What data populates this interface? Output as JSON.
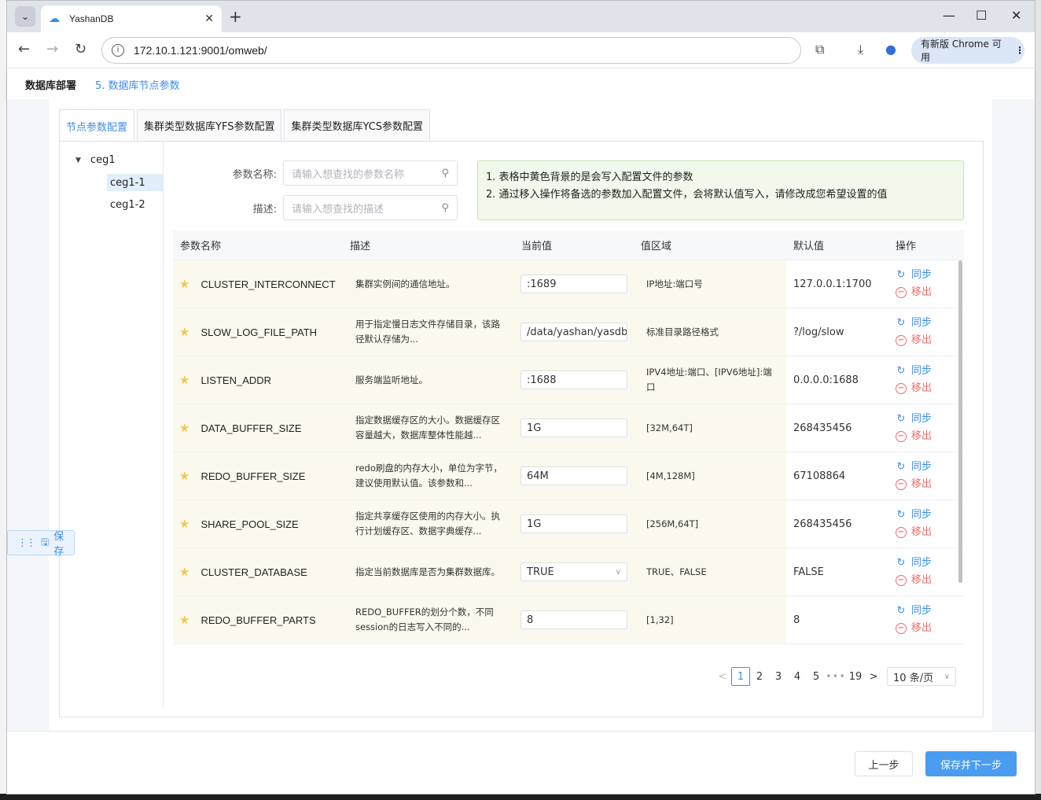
{
  "browser": {
    "tab_title": "YashanDB",
    "url": "172.10.1.121:9001/omweb/",
    "update_label": "有新版 Chrome 可用"
  },
  "header": {
    "section": "数据库部署",
    "step": "5. 数据库节点参数"
  },
  "tabs": [
    {
      "label": "节点参数配置",
      "active": true
    },
    {
      "label": "集群类型数据库YFS参数配置",
      "active": false
    },
    {
      "label": "集群类型数据库YCS参数配置",
      "active": false
    }
  ],
  "tree": {
    "root": "ceg1",
    "children": [
      "ceg1-1",
      "ceg1-2"
    ],
    "selected": "ceg1-1"
  },
  "search": {
    "name_label": "参数名称:",
    "name_placeholder": "请输入想查找的参数名称",
    "desc_label": "描述:",
    "desc_placeholder": "请输入想查找的描述"
  },
  "notice": {
    "line1": "1. 表格中黄色背景的是会写入配置文件的参数",
    "line2": "2. 通过移入操作将备选的参数加入配置文件，会将默认值写入，请修改成您希望设置的值"
  },
  "table": {
    "columns": [
      "参数名称",
      "描述",
      "当前值",
      "值区域",
      "默认值",
      "操作"
    ],
    "sync_label": "同步",
    "remove_label": "移出",
    "rows": [
      {
        "name": "CLUSTER_INTERCONNECT",
        "desc": "集群实例间的通信地址。",
        "current": ":1689",
        "range": "IP地址:端口号",
        "default": "127.0.0.1:1700",
        "is_select": false
      },
      {
        "name": "SLOW_LOG_FILE_PATH",
        "desc": "用于指定慢日志文件存储目录，该路径默认存储为...",
        "current": "/data/yashan/yasdb",
        "range": "标准目录路径格式",
        "default": "?/log/slow",
        "is_select": false
      },
      {
        "name": "LISTEN_ADDR",
        "desc": "服务端监听地址。",
        "current": ":1688",
        "range": "IPV4地址:端口、[IPV6地址]:端口",
        "default": "0.0.0.0:1688",
        "is_select": false
      },
      {
        "name": "DATA_BUFFER_SIZE",
        "desc": "指定数据缓存区的大小。数据缓存区容量越大，数据库整体性能越...",
        "current": "1G",
        "range": "[32M,64T]",
        "default": "268435456",
        "is_select": false
      },
      {
        "name": "REDO_BUFFER_SIZE",
        "desc": "redo刷盘的内存大小，单位为字节，建议使用默认值。该参数和...",
        "current": "64M",
        "range": "[4M,128M]",
        "default": "67108864",
        "is_select": false
      },
      {
        "name": "SHARE_POOL_SIZE",
        "desc": "指定共享缓存区使用的内存大小。执行计划缓存区、数据字典缓存...",
        "current": "1G",
        "range": "[256M,64T]",
        "default": "268435456",
        "is_select": false
      },
      {
        "name": "CLUSTER_DATABASE",
        "desc": "指定当前数据库是否为集群数据库。",
        "current": "TRUE",
        "range": "TRUE、FALSE",
        "default": "FALSE",
        "is_select": true
      },
      {
        "name": "REDO_BUFFER_PARTS",
        "desc": "REDO_BUFFER的划分个数，不同session的日志写入不同的...",
        "current": "8",
        "range": "[1,32]",
        "default": "8",
        "is_select": false
      }
    ]
  },
  "pagination": {
    "pages": [
      "1",
      "2",
      "3",
      "4",
      "5"
    ],
    "current": "1",
    "more": "•••",
    "last": "19",
    "page_size": "10 条/页"
  },
  "float_save": "保存",
  "footer": {
    "prev": "上一步",
    "next": "保存并下一步"
  },
  "colors": {
    "accent": "#3f8ee8",
    "danger": "#f56c6c",
    "row_highlight": "#fbf9ee",
    "notice_bg": "#f0f9eb"
  }
}
